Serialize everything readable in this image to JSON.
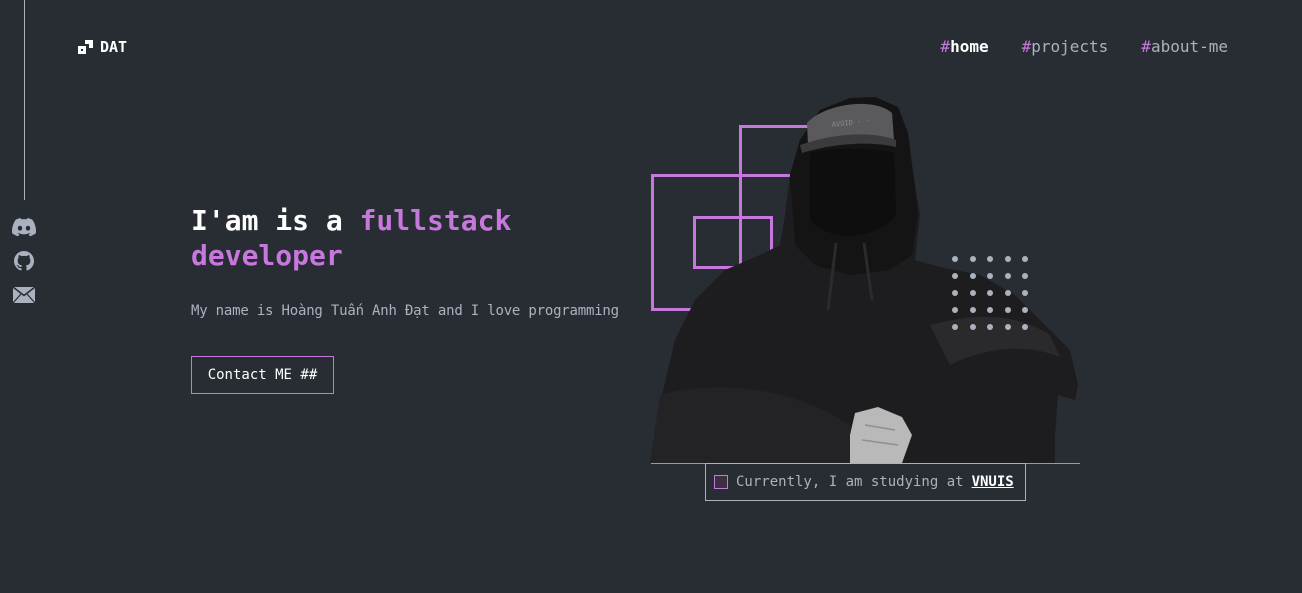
{
  "colors": {
    "background": "#282c33",
    "accent": "#c778dd",
    "text_gray": "#abb2bf",
    "text_white": "#ffffff"
  },
  "header": {
    "logo_text": "DAT",
    "logo_icon": "dat-logo-icon",
    "nav": [
      {
        "hash": "#",
        "label": "home",
        "active": true
      },
      {
        "hash": "#",
        "label": "projects",
        "active": false
      },
      {
        "hash": "#",
        "label": "about-me",
        "active": false
      }
    ]
  },
  "social": [
    {
      "icon": "discord-icon"
    },
    {
      "icon": "github-icon"
    },
    {
      "icon": "email-icon"
    }
  ],
  "hero": {
    "headline_1": "I'am is a ",
    "headline_accent_1": "fullstack",
    "headline_accent_2": "developer",
    "description": "My name is Hoàng Tuấn Anh Đạt and I love programming",
    "contact_button": "Contact ME ##"
  },
  "status": {
    "text": "Currently, I am studying at",
    "link": "VNUIS"
  }
}
